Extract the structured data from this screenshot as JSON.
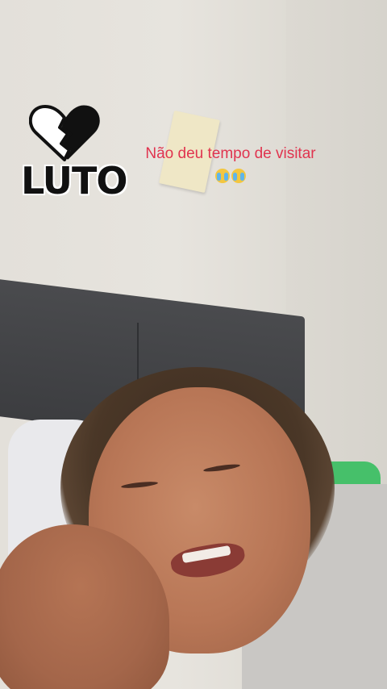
{
  "overlay": {
    "badge_text": "LUTO",
    "badge_icon": "broken-heart-icon",
    "caption_line1": "Não deu tempo de visitar",
    "caption_emoji": "😭😭"
  },
  "colors": {
    "caption": "#e0344f",
    "badge": "#111111"
  }
}
